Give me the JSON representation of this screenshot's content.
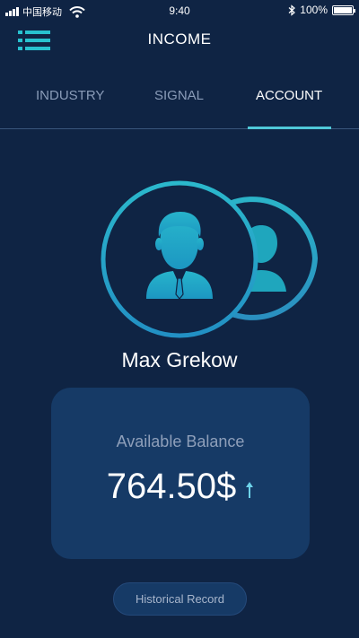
{
  "status_bar": {
    "carrier": "中国移动",
    "time": "9:40",
    "battery": "100%"
  },
  "header": {
    "title": "INCOME",
    "menu_icon": "menu-list-icon"
  },
  "tabs": [
    {
      "label": "INDUSTRY",
      "active": false
    },
    {
      "label": "SIGNAL",
      "active": false
    },
    {
      "label": "ACCOUNT",
      "active": true
    }
  ],
  "profile": {
    "name": "Max Grekow",
    "avatar_icon": "user-avatar-icon"
  },
  "balance": {
    "label": "Available Balance",
    "value": "764.50$",
    "trend_icon": "arrow-up-icon"
  },
  "history_button": {
    "label": "Historical Record"
  },
  "colors": {
    "background": "#0f2444",
    "card": "#163a66",
    "accent": "#28c1cf",
    "inactive_text": "#8a9cb8"
  }
}
